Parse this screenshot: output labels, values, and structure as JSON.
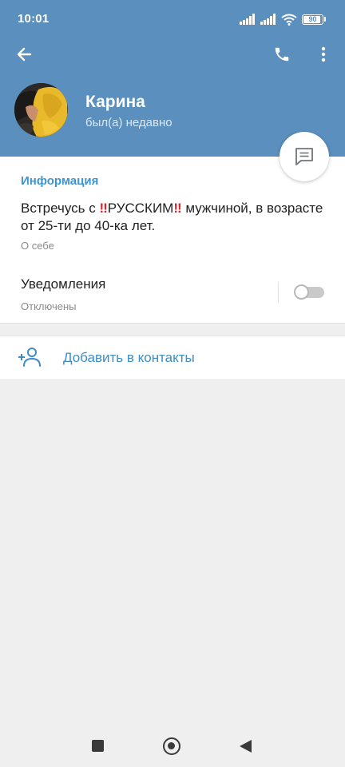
{
  "status_bar": {
    "time": "10:01",
    "battery": "90",
    "icons": [
      "signal-icon",
      "signal-icon",
      "wifi-icon",
      "battery-icon"
    ]
  },
  "toolbar": {
    "back_icon": "arrow-left-icon",
    "call_icon": "phone-icon",
    "more_icon": "more-vertical-icon"
  },
  "profile": {
    "name": "Карина",
    "status": "был(а) недавно"
  },
  "info": {
    "section_title": "Информация",
    "bio_before": "Встречусь с ",
    "bio_emoji": "‼",
    "bio_word": "РУССКИМ",
    "bio_after": " мужчиной, в возрасте от 25-ти до 40-ка лет.",
    "bio_caption": "О себе"
  },
  "notifications": {
    "title": "Уведомления",
    "state": "Отключены",
    "enabled": false
  },
  "actions": {
    "add_contact": "Добавить в контакты"
  },
  "colors": {
    "header": "#5a8fbe",
    "accent": "#3e95cf",
    "background": "#efefef",
    "emoji_red": "#d8232a"
  }
}
